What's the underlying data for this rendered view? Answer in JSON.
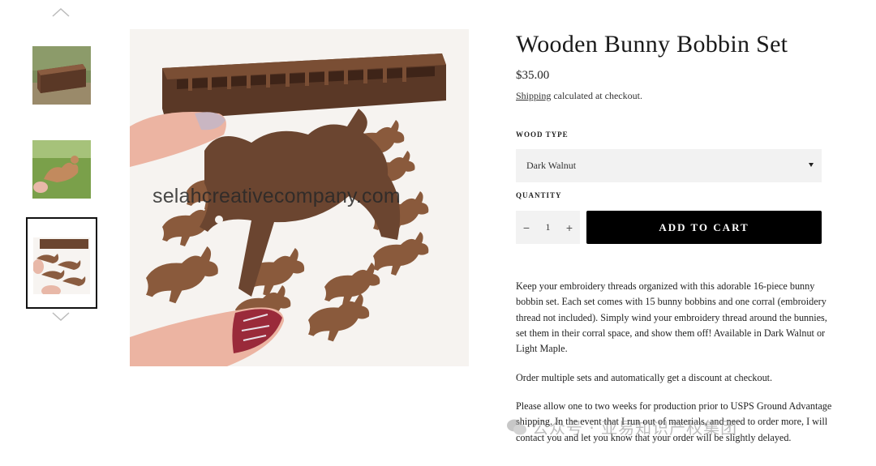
{
  "gallery": {
    "up_icon": "chevron-up-icon",
    "down_icon": "chevron-down-icon",
    "thumbnails": [
      {
        "alt": "bobbin corral on grass"
      },
      {
        "alt": "bunny bobbins on grass"
      },
      {
        "alt": "bunny bobbins and corral"
      }
    ],
    "main_watermark": "selahcreativecompany.com"
  },
  "product": {
    "title": "Wooden Bunny Bobbin Set",
    "price": "$35.00",
    "shipping_link": "Shipping",
    "shipping_rest": " calculated at checkout.",
    "wood_type_label": "Wood type",
    "wood_type_selected": "Dark Walnut",
    "quantity_label": "Quantity",
    "quantity_minus": "−",
    "quantity_value": "1",
    "quantity_plus": "+",
    "add_to_cart": "Add to cart",
    "description": [
      "Keep your embroidery threads organized with this adorable 16-piece bunny bobbin set. Each set comes with 15 bunny bobbins and one corral (embroidery thread not included). Simply wind your embroidery thread around the bunnies, set them in their corral space, and show them off! Available in Dark Walnut or Light Maple.",
      "Order multiple sets and automatically get a discount at checkout.",
      "Please allow one to two weeks for production prior to USPS Ground Advantage shipping. In the event that I run out of materials, and need to order more, I will contact you and let you know that your order will be slightly delayed."
    ]
  },
  "overlay_watermark": "公众号 · 亚易知识产权集团",
  "colors": {
    "walnut": "#6b4530",
    "walnut_dark": "#4a2e1f",
    "button": "#000000",
    "field_bg": "#f2f2f2"
  }
}
